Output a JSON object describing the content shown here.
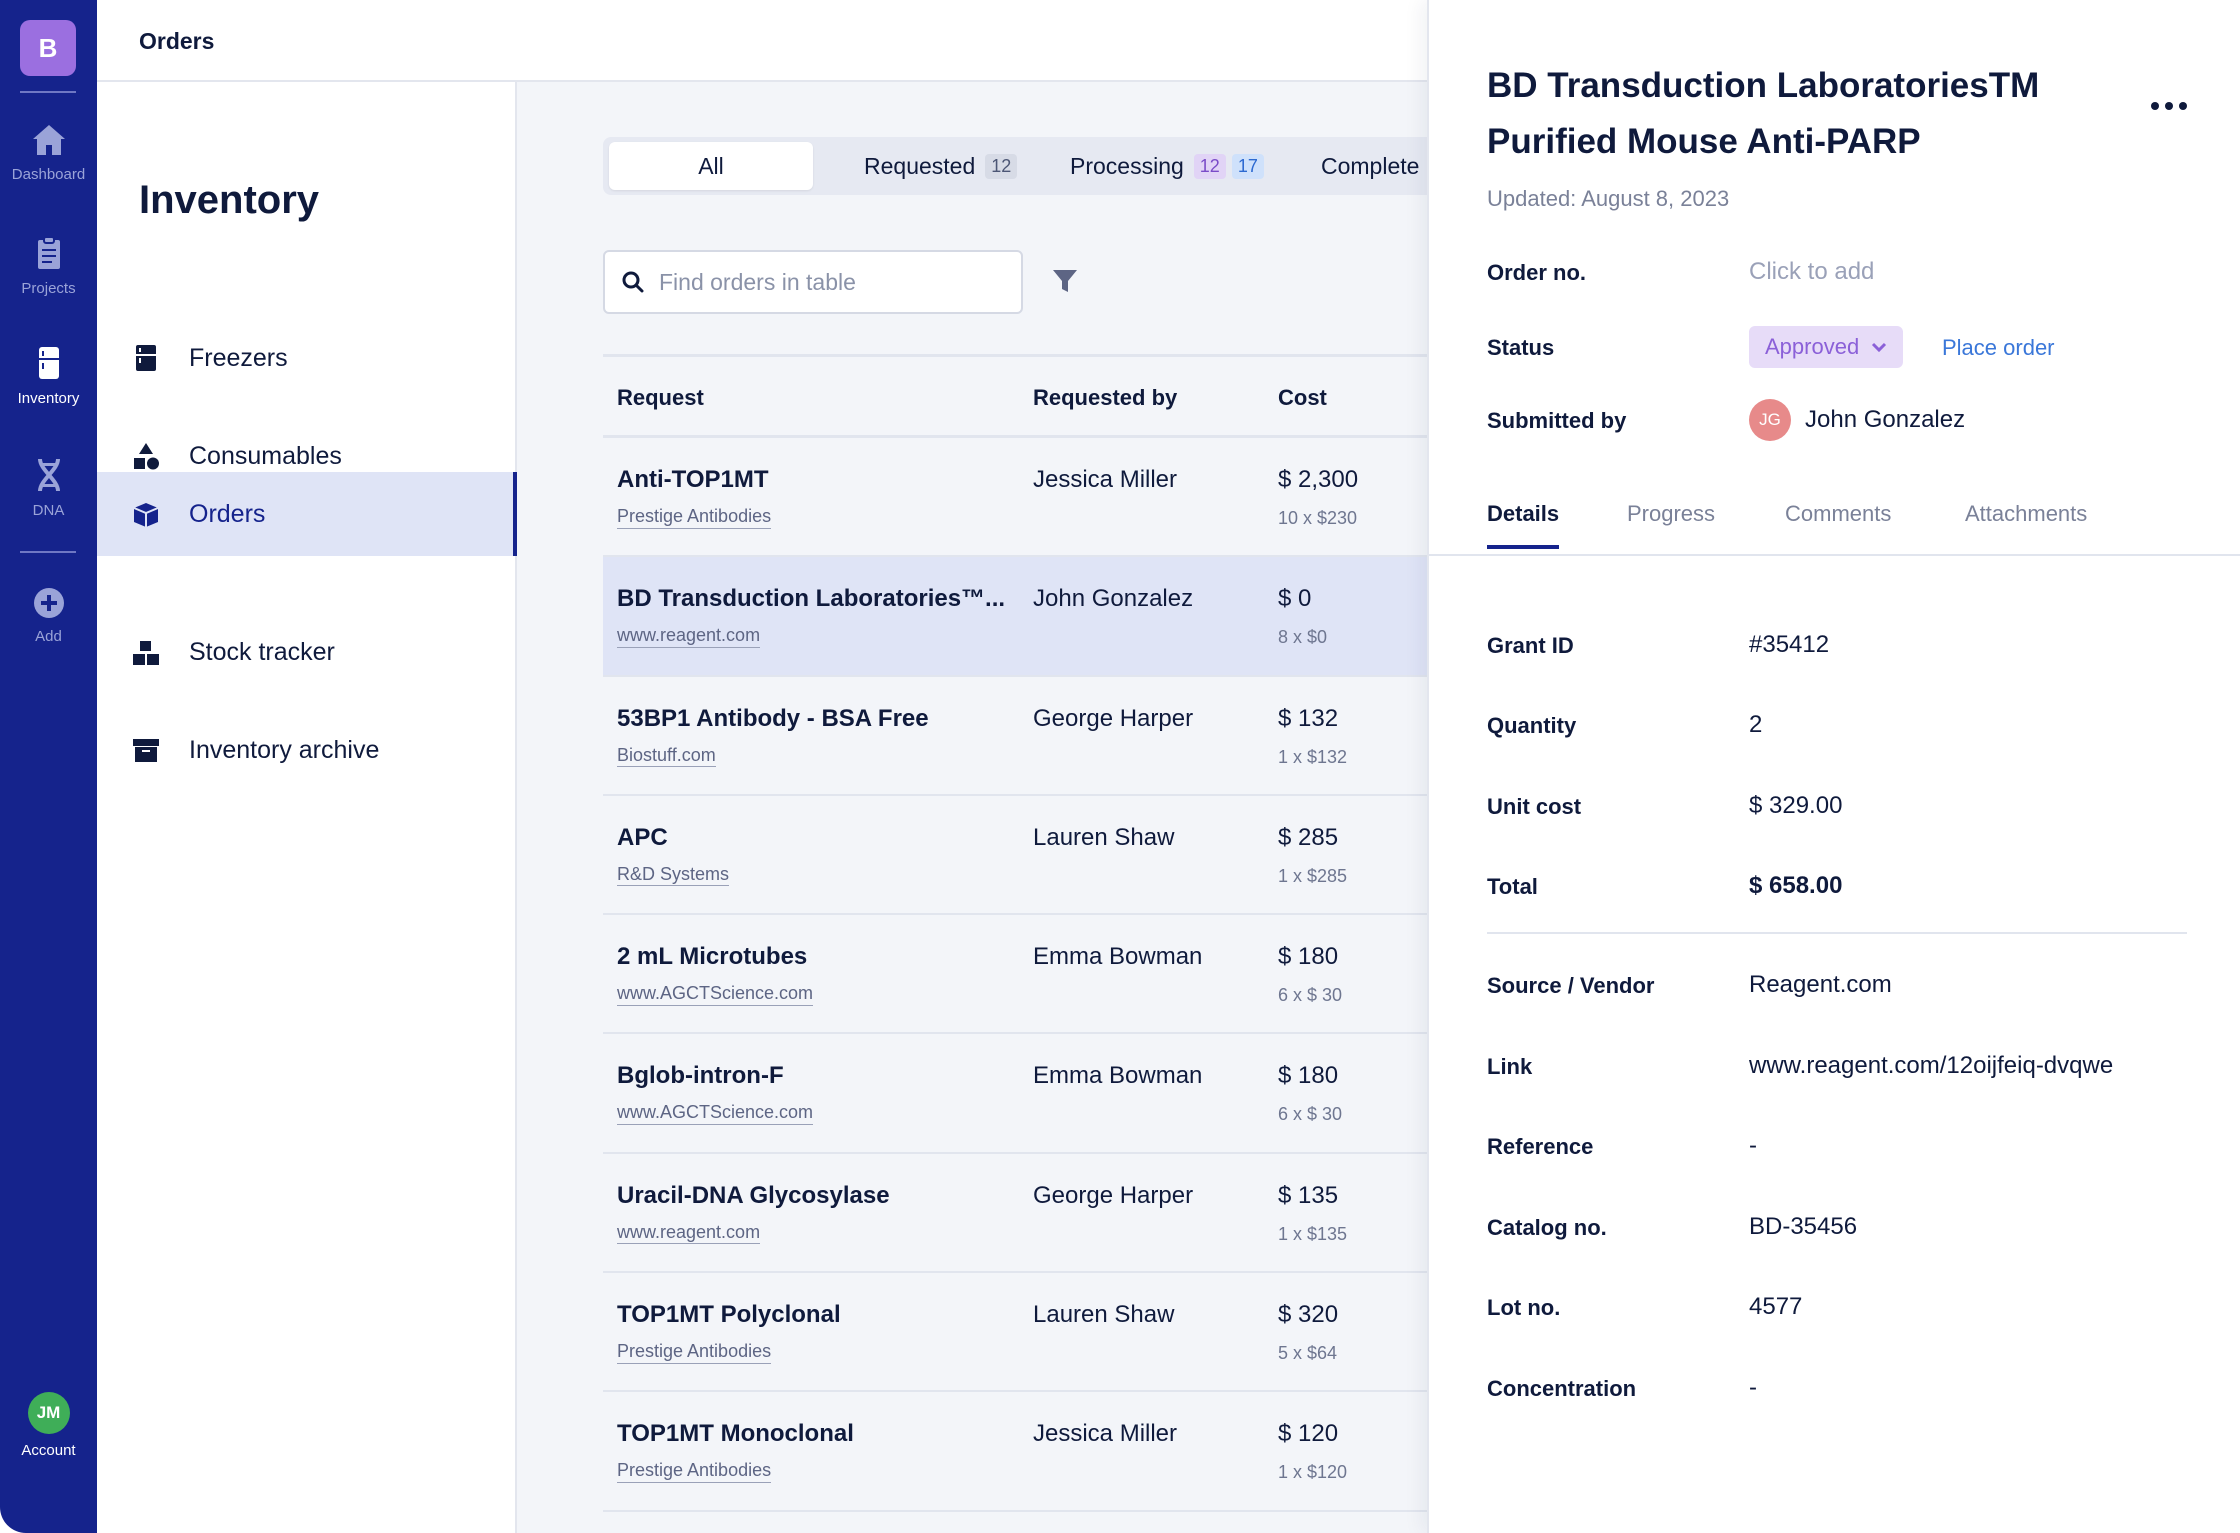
{
  "rail": {
    "logo": "B",
    "items": [
      {
        "label": "Dashboard"
      },
      {
        "label": "Projects"
      },
      {
        "label": "Inventory"
      },
      {
        "label": "DNA"
      },
      {
        "label": "Add"
      }
    ],
    "account": {
      "initials": "JM",
      "label": "Account"
    }
  },
  "header": {
    "title": "Orders"
  },
  "sidebar": {
    "title": "Inventory",
    "items": [
      {
        "label": "Freezers"
      },
      {
        "label": "Consumables"
      },
      {
        "label": "Orders"
      },
      {
        "label": "Stock tracker"
      },
      {
        "label": "Inventory archive"
      }
    ]
  },
  "tabs": {
    "all": "All",
    "requested": "Requested",
    "requested_count": "12",
    "processing": "Processing",
    "processing_count_a": "12",
    "processing_count_b": "17",
    "complete": "Complete"
  },
  "search": {
    "placeholder": "Find orders in table"
  },
  "table": {
    "headers": {
      "request": "Request",
      "requested_by": "Requested by",
      "cost": "Cost"
    },
    "rows": [
      {
        "title": "Anti-TOP1MT",
        "vendor": "Prestige Antibodies",
        "person": "Jessica Miller",
        "cost": "$ 2,300",
        "qty": "10 x $230"
      },
      {
        "title": "BD Transduction Laboratories™...",
        "vendor": "www.reagent.com",
        "person": "John Gonzalez",
        "cost": "$ 0",
        "qty": "8 x $0"
      },
      {
        "title": "53BP1 Antibody - BSA Free",
        "vendor": "Biostuff.com",
        "person": "George Harper",
        "cost": "$ 132",
        "qty": "1 x $132"
      },
      {
        "title": "APC",
        "vendor": "R&D Systems",
        "person": "Lauren Shaw",
        "cost": "$ 285",
        "qty": "1 x $285"
      },
      {
        "title": "2 mL Microtubes",
        "vendor": "www.AGCTScience.com",
        "person": "Emma Bowman",
        "cost": "$ 180",
        "qty": "6 x $ 30"
      },
      {
        "title": "Bglob-intron-F",
        "vendor": "www.AGCTScience.com",
        "person": "Emma Bowman",
        "cost": "$ 180",
        "qty": "6 x $ 30"
      },
      {
        "title": "Uracil-DNA Glycosylase",
        "vendor": "www.reagent.com",
        "person": "George Harper",
        "cost": "$ 135",
        "qty": "1 x $135"
      },
      {
        "title": "TOP1MT Polyclonal",
        "vendor": "Prestige Antibodies",
        "person": "Lauren Shaw",
        "cost": "$ 320",
        "qty": "5 x $64"
      },
      {
        "title": "TOP1MT Monoclonal",
        "vendor": "Prestige Antibodies",
        "person": "Jessica Miller",
        "cost": "$ 120",
        "qty": "1 x $120"
      }
    ]
  },
  "panel": {
    "title": "BD Transduction LaboratoriesTM Purified Mouse Anti-PARP",
    "updated": "Updated: August 8, 2023",
    "order_no_label": "Order no.",
    "order_no_value": "Click to add",
    "status_label": "Status",
    "status_value": "Approved",
    "place_order": "Place order",
    "submitted_label": "Submitted by",
    "submitted_initials": "JG",
    "submitted_name": "John Gonzalez",
    "tabs": [
      "Details",
      "Progress",
      "Comments",
      "Attachments"
    ],
    "details": [
      {
        "label": "Grant ID",
        "value": "#35412"
      },
      {
        "label": "Quantity",
        "value": "2"
      },
      {
        "label": "Unit cost",
        "value": "$ 329.00"
      },
      {
        "label": "Total",
        "value": "$ 658.00"
      }
    ],
    "details2": [
      {
        "label": "Source / Vendor",
        "value": "Reagent.com"
      },
      {
        "label": "Link",
        "value": "www.reagent.com/12oijfeiq-dvqwe"
      },
      {
        "label": "Reference",
        "value": "-"
      },
      {
        "label": "Catalog no.",
        "value": "BD-35456"
      },
      {
        "label": "Lot no.",
        "value": "4577"
      },
      {
        "label": "Concentration",
        "value": "-"
      }
    ]
  },
  "colors": {
    "rail": "#15238c",
    "logo": "#9b6fe0",
    "selected_row": "#dfe4f6",
    "status_bg": "#e7dcf8",
    "status_text": "#8b60d8",
    "link": "#3a77d9"
  }
}
